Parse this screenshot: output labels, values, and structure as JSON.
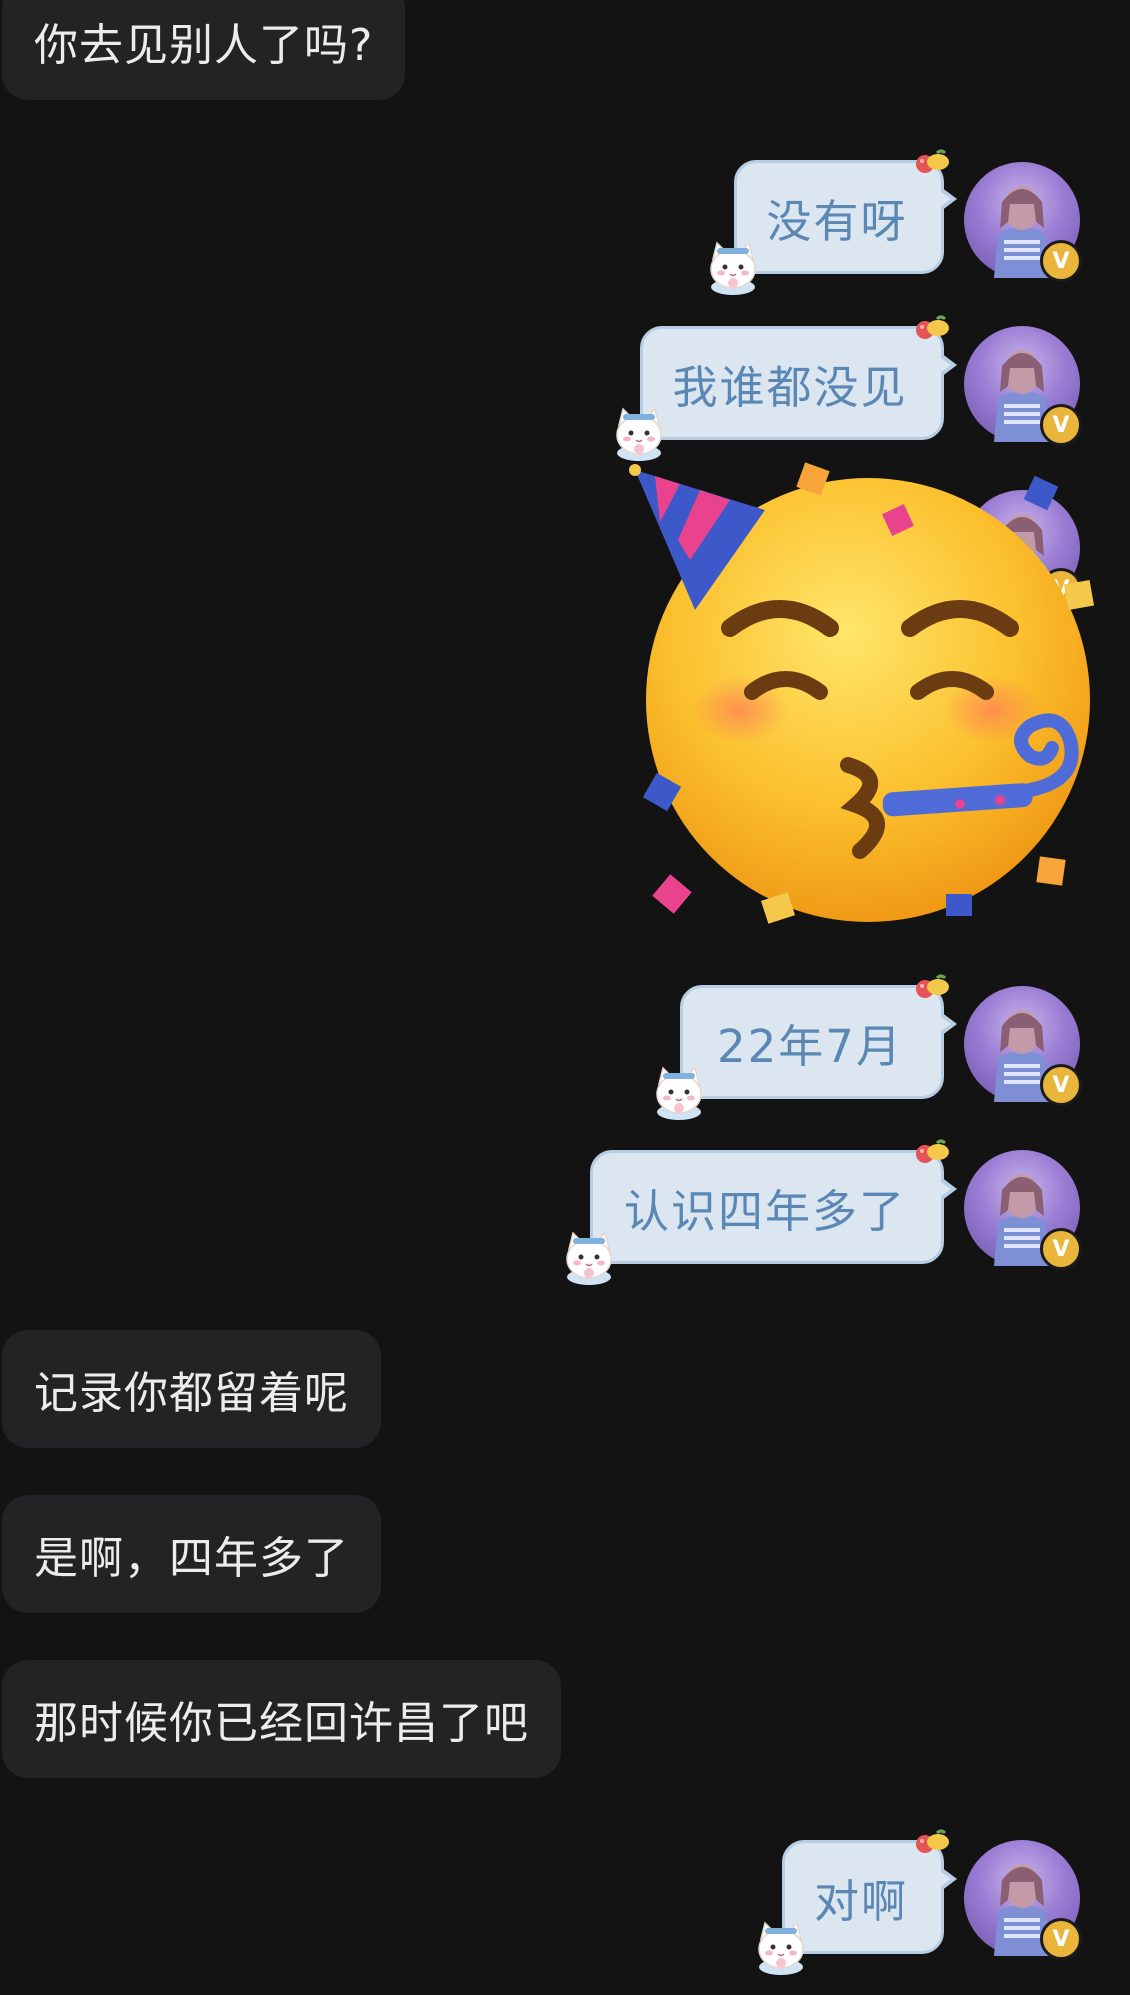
{
  "messages": [
    {
      "side": "in",
      "text": "你去见别人了吗?"
    },
    {
      "side": "out",
      "text": "没有呀"
    },
    {
      "side": "out",
      "text": "我谁都没见"
    },
    {
      "side": "out",
      "type": "sticker",
      "sticker": "partying-face-emoji"
    },
    {
      "side": "out",
      "text": "22年7月"
    },
    {
      "side": "out",
      "text": "认识四年多了"
    },
    {
      "side": "in",
      "text": "记录你都留着呢"
    },
    {
      "side": "in",
      "text": "是啊，四年多了"
    },
    {
      "side": "in",
      "text": "那时候你已经回许昌了吧"
    },
    {
      "side": "out",
      "text": "对啊"
    }
  ],
  "avatar": {
    "badge": "V"
  },
  "theme": {
    "background": "#131314",
    "incoming_bubble": "#232325",
    "outgoing_bubble": "#dce6f0",
    "outgoing_text": "#5a87b4",
    "badge": "#e9b53a"
  }
}
